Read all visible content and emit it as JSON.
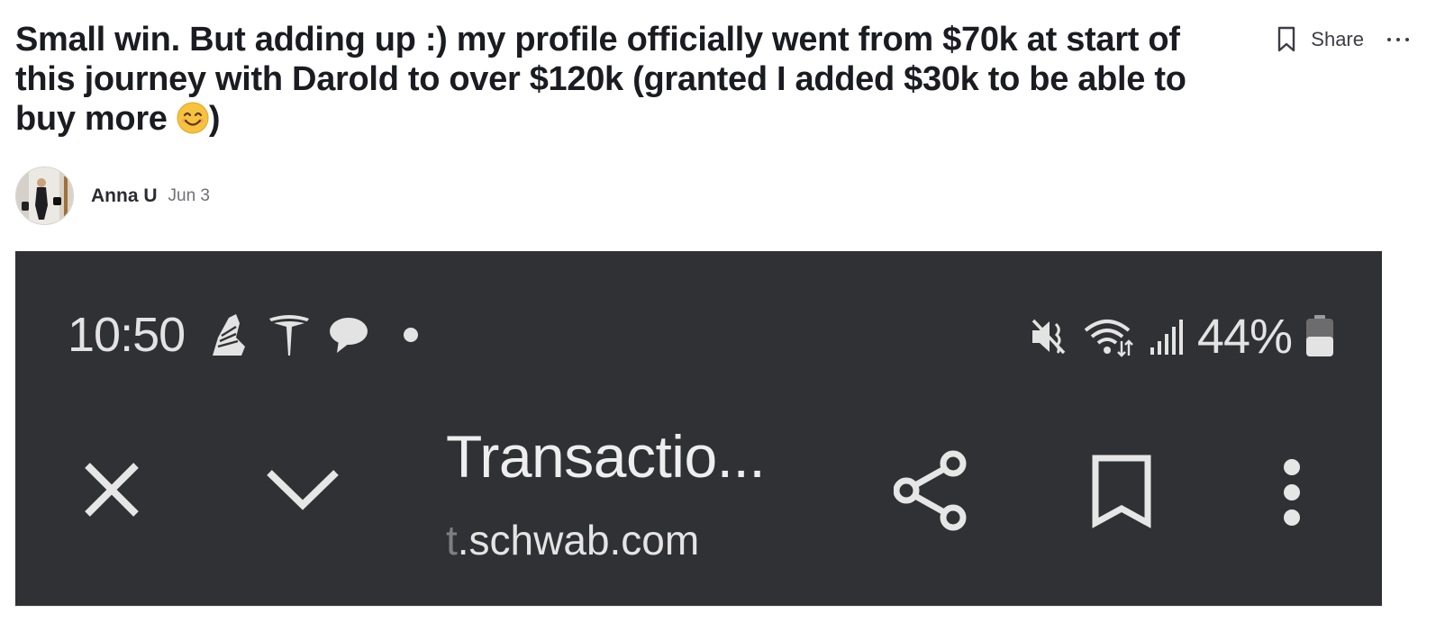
{
  "post": {
    "title": "Small win. But adding up :) my profile officially went from $70k at start of this journey with Darold to over $120k (granted I added $30k to be able to buy more",
    "title_end": ")",
    "author": "Anna U",
    "date": "Jun 3"
  },
  "actions": {
    "share_label": "Share"
  },
  "screenshot": {
    "time": "10:50",
    "battery": "44%",
    "page_title": "Transactio...",
    "url_fade": "t",
    "url": ".schwab.com"
  },
  "colors": {
    "screenshot_bg": "#303134",
    "title_text": "#1b1c22"
  },
  "icons": [
    "bookmark-icon",
    "more-icon",
    "close-icon",
    "chevron-down-icon",
    "share-icon",
    "bookmark-icon",
    "kebab-menu-icon",
    "wifi-icon",
    "signal-icon",
    "battery-icon",
    "mute-icon",
    "tesla-icon",
    "chat-icon",
    "running-shoe-icon"
  ]
}
